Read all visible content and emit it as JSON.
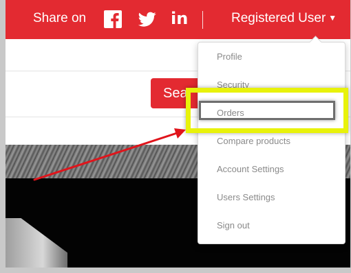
{
  "header": {
    "share_label": "Share on",
    "social_icons": [
      "facebook-icon",
      "twitter-icon",
      "linkedin-icon"
    ],
    "linkedin_text": "in",
    "user_menu_label": "Registered User"
  },
  "search": {
    "button_label": "Sea"
  },
  "user_dropdown": {
    "items": [
      {
        "label": "Profile"
      },
      {
        "label": "Security"
      },
      {
        "label": "Orders"
      },
      {
        "label": "Compare products"
      },
      {
        "label": "Account Settings"
      },
      {
        "label": "Users Settings"
      },
      {
        "label": "Sign out"
      }
    ]
  },
  "annotations": {
    "highlight_color": "#e8f20a",
    "arrow_color": "#e0141b",
    "highlighted_item": "Orders"
  },
  "colors": {
    "brand_red": "#e32a31",
    "menu_text": "#8a8a8a"
  }
}
